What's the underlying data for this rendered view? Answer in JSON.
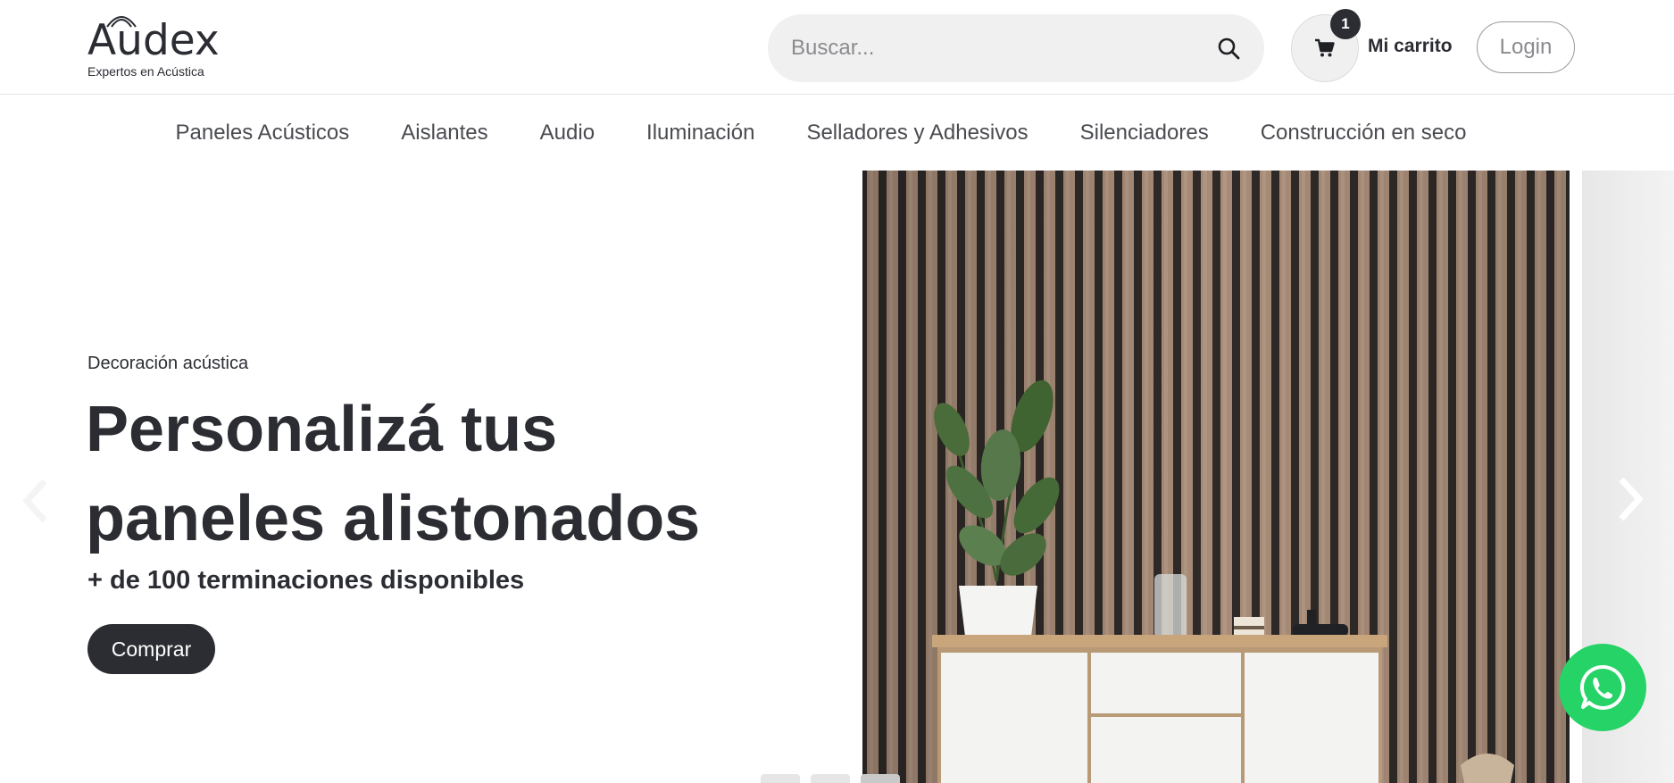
{
  "header": {
    "logo": {
      "wordmark": "Audex",
      "tagline": "Expertos en Acústica"
    },
    "search": {
      "placeholder": "Buscar...",
      "icon": "search-icon"
    },
    "cart": {
      "icon": "cart-icon",
      "count": "1",
      "label": "Mi carrito"
    },
    "login_label": "Login"
  },
  "nav": {
    "items": [
      {
        "label": "Paneles Acústicos"
      },
      {
        "label": "Aislantes"
      },
      {
        "label": "Audio"
      },
      {
        "label": "Iluminación"
      },
      {
        "label": "Selladores y Adhesivos"
      },
      {
        "label": "Silenciadores"
      },
      {
        "label": "Construcción en seco"
      }
    ]
  },
  "hero": {
    "eyebrow": "Decoración acústica",
    "headline": "Personalizá tus paneles alistonados",
    "subhead": "+ de 100 terminaciones disponibles",
    "cta_label": "Comprar",
    "prev_icon": "chevron-left-icon",
    "next_icon": "chevron-right-icon",
    "slide_count": 3,
    "active_slide": 3
  },
  "whatsapp": {
    "icon": "whatsapp-icon"
  },
  "colors": {
    "text": "#2b2d33",
    "search_bg": "#f1f0f0",
    "whatsapp": "#25d366",
    "button_dark": "#2b2d33"
  }
}
